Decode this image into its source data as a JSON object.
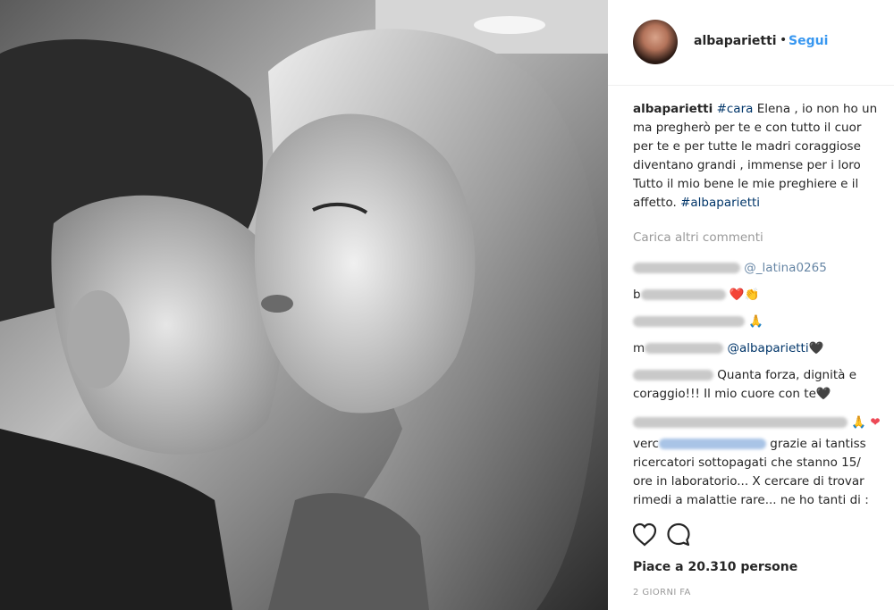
{
  "post": {
    "username": "albaparietti",
    "dot": "•",
    "follow_label": "Segui"
  },
  "caption": {
    "username": "albaparietti",
    "tag1": "#cara",
    "line1": " Elena , io non ho un",
    "line2": "ma pregherò per te e con tutto il cuor",
    "line3": "per te e per tutte le madri coraggiose",
    "line4": "diventano grandi , immense per i loro",
    "line5": "Tutto il mio bene le mie preghiere e il",
    "line6a": "affetto. ",
    "tag2": "#albaparietti"
  },
  "load_more_label": "Carica altri commenti",
  "comments": {
    "c1_mention": "@_latina0265",
    "c2_prefix": "b",
    "c2_emoji": "❤️👏",
    "c3_emoji": "🙏",
    "c4_prefix": "m",
    "c4_mention": "@albaparietti",
    "c4_suffix": "🖤",
    "c5_line1": "Quanta forza, dignità e",
    "c5_line2": "coraggio!!! Il mio cuore con te🖤",
    "c6_emoji": "🙏 ❤",
    "c7_prefix": "verc",
    "c7_line1": " grazie ai tantiss",
    "c7_line2": "ricercatori sottopagati che stanno 15/",
    "c7_line3": "ore in laboratorio... X cercare di trovar",
    "c7_line4": "rimedi a malattie rare... ne ho tanti di :"
  },
  "actions": {
    "like_icon": "heart-icon",
    "comment_icon": "comment-icon"
  },
  "likes_label": "Piace a 20.310 persone",
  "timestamp": "2 GIORNI FA"
}
